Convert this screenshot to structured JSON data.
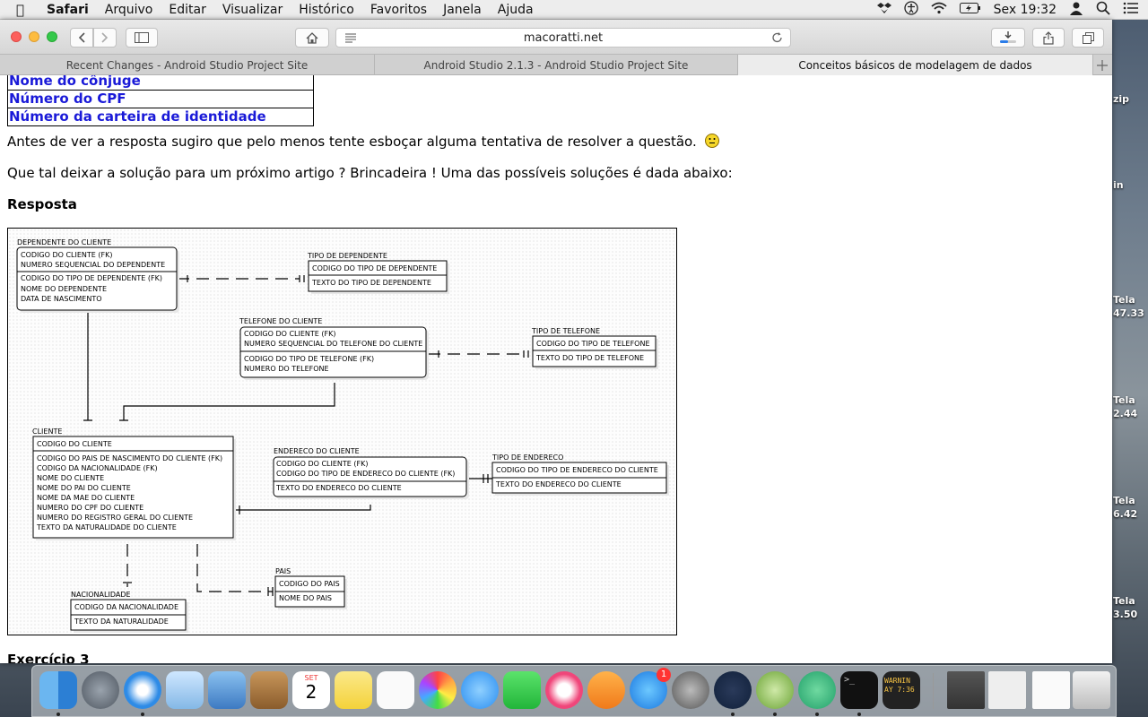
{
  "menubar": {
    "app": "Safari",
    "items": [
      "Arquivo",
      "Editar",
      "Visualizar",
      "Histórico",
      "Favoritos",
      "Janela",
      "Ajuda"
    ],
    "clock": "Sex 19:32"
  },
  "browser": {
    "url": "macoratti.net",
    "tabs": [
      {
        "label": "Recent Changes - Android Studio Project Site",
        "active": false
      },
      {
        "label": "Android Studio 2.1.3 - Android Studio Project Site",
        "active": false
      },
      {
        "label": "Conceitos básicos de modelagem de dados",
        "active": true
      }
    ]
  },
  "page": {
    "table_rows": [
      "Nome do cônjuge",
      "Número do CPF",
      "Número da carteira de identidade"
    ],
    "para1": "Antes de ver a resposta sugiro que pelo menos tente esboçar alguma tentativa de resolver a questão.",
    "para2": "Que tal deixar a solução para um próximo artigo ? Brincadeira ! Uma das possíveis soluções é dada abaixo:",
    "resposta": "Resposta",
    "exercicio": "Exercício 3"
  },
  "diagram": {
    "entities": {
      "dependente": {
        "title": "DEPENDENTE DO CLIENTE",
        "keys": [
          "CODIGO DO CLIENTE (FK)",
          "NUMERO SEQUENCIAL DO DEPENDENTE"
        ],
        "attrs": [
          "CODIGO DO TIPO DE DEPENDENTE (FK)",
          "NOME DO DEPENDENTE",
          "DATA DE NASCIMENTO"
        ]
      },
      "tipo_dependente": {
        "title": "TIPO DE DEPENDENTE",
        "keys": [
          "CODIGO DO TIPO DE DEPENDENTE"
        ],
        "attrs": [
          "TEXTO DO TIPO DE DEPENDENTE"
        ]
      },
      "telefone": {
        "title": "TELEFONE DO CLIENTE",
        "keys": [
          "CODIGO DO CLIENTE (FK)",
          "NUMERO SEQUENCIAL DO TELEFONE DO CLIENTE"
        ],
        "attrs": [
          "CODIGO DO TIPO DE TELEFONE (FK)",
          "NUMERO DO TELEFONE"
        ]
      },
      "tipo_telefone": {
        "title": "TIPO DE TELEFONE",
        "keys": [
          "CODIGO DO TIPO DE TELEFONE"
        ],
        "attrs": [
          "TEXTO DO TIPO DE TELEFONE"
        ]
      },
      "cliente": {
        "title": "CLIENTE",
        "keys": [
          "CODIGO DO CLIENTE"
        ],
        "attrs": [
          "CODIGO DO PAIS DE NASCIMENTO DO CLIENTE (FK)",
          "CODIGO DA NACIONALIDADE (FK)",
          "NOME DO CLIENTE",
          "NOME DO PAI DO CLIENTE",
          "NOME DA MAE DO CLIENTE",
          "NUMERO DO CPF DO CLIENTE",
          "NUMERO DO REGISTRO GERAL DO CLIENTE",
          "TEXTO DA NATURALIDADE DO CLIENTE"
        ]
      },
      "endereco": {
        "title": "ENDERECO DO CLIENTE",
        "keys": [
          "CODIGO DO CLIENTE (FK)",
          "CODIGO DO TIPO DE ENDERECO DO CLIENTE (FK)"
        ],
        "attrs": [
          "TEXTO DO ENDERECO DO CLIENTE"
        ]
      },
      "tipo_endereco": {
        "title": "TIPO DE ENDERECO",
        "keys": [
          "CODIGO DO TIPO DE ENDERECO DO CLIENTE"
        ],
        "attrs": [
          "TEXTO DO ENDERECO DO CLIENTE"
        ]
      },
      "pais": {
        "title": "PAIS",
        "keys": [
          "CODIGO DO PAIS"
        ],
        "attrs": [
          "NOME DO PAIS"
        ]
      },
      "nacionalidade": {
        "title": "NACIONALIDADE",
        "keys": [
          "CODIGO DA NACIONALIDADE"
        ],
        "attrs": [
          "TEXTO DA NATURALIDADE"
        ]
      }
    }
  },
  "desktop_labels": [
    "zip",
    "in",
    "Tela",
    "47.33",
    "Tela",
    "2.44",
    "Tela",
    "6.42",
    "Tela",
    "3.50"
  ],
  "dock": {
    "apps": [
      "finder-icon",
      "launchpad-icon",
      "safari-icon",
      "preview-icon",
      "mail-icon",
      "contacts-icon",
      "calendar-icon",
      "notes-icon",
      "reminders-icon",
      "photos-icon",
      "messages-icon",
      "facetime-icon",
      "itunes-icon",
      "ibooks-icon",
      "appstore-icon",
      "system-preferences-icon",
      "sourcetree-icon",
      "android-studio-icon",
      "atom-icon",
      "terminal-icon",
      "console-icon",
      "screenshot-icon",
      "screenshot-icon",
      "screenshot-icon",
      "trash-icon"
    ],
    "calendar_month": "SET",
    "calendar_day": "2",
    "appstore_badge": "1",
    "console_text": "WARNIN",
    "console_text2": "AY 7:36"
  }
}
